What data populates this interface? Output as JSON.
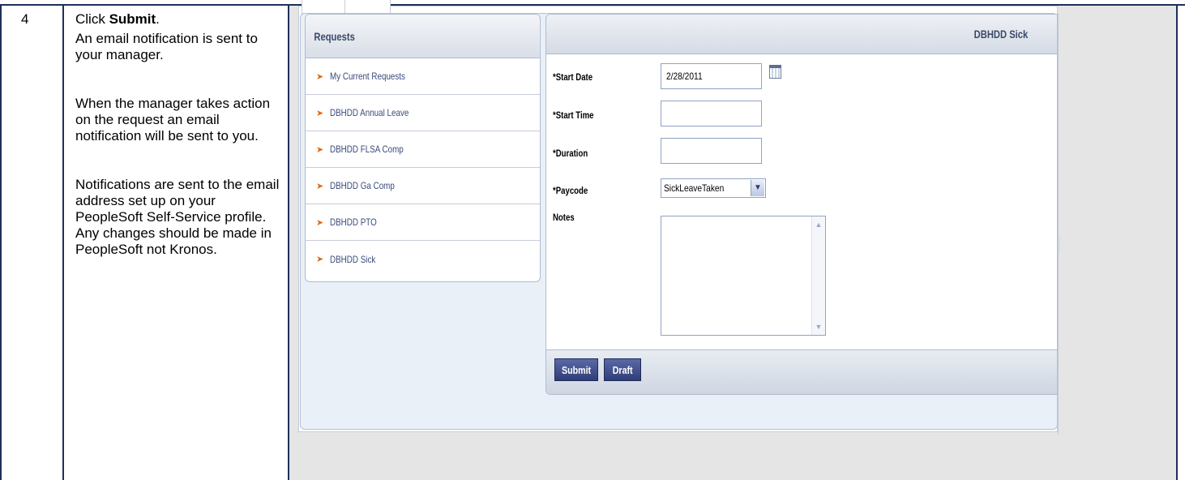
{
  "document": {
    "step_number": "4",
    "instruction_prefix": "Click ",
    "instruction_bold": "Submit",
    "instruction_suffix": ".",
    "para1": "An email notification is sent to your manager.",
    "para2": "When the manager takes action on the request an email notification will be sent to you.",
    "para3": "Notifications are sent to the email address set up on your PeopleSoft Self-Service profile. Any changes should be made in PeopleSoft not Kronos."
  },
  "requests_panel": {
    "title": "Requests",
    "items": [
      {
        "label": "My Current Requests"
      },
      {
        "label": "DBHDD Annual Leave"
      },
      {
        "label": "DBHDD FLSA Comp"
      },
      {
        "label": "DBHDD Ga Comp"
      },
      {
        "label": "DBHDD PTO"
      },
      {
        "label": "DBHDD Sick"
      }
    ]
  },
  "form": {
    "title": "DBHDD Sick",
    "start_date_label": "*Start Date",
    "start_date_value": "2/28/2011",
    "start_time_label": "*Start Time",
    "start_time_value": "",
    "duration_label": "*Duration",
    "duration_value": "",
    "paycode_label": "*Paycode",
    "paycode_value": "SickLeaveTaken",
    "notes_label": "Notes",
    "notes_value": "",
    "submit_label": "Submit",
    "draft_label": "Draft"
  },
  "icons": {
    "calendar": "calendar-icon",
    "dropdown": "chevron-down-icon",
    "list_arrow": "arrow-right-icon"
  },
  "colors": {
    "accent_arrow": "#e06a1a",
    "button": "#2f3d78",
    "table_border": "#1f2f5a"
  }
}
